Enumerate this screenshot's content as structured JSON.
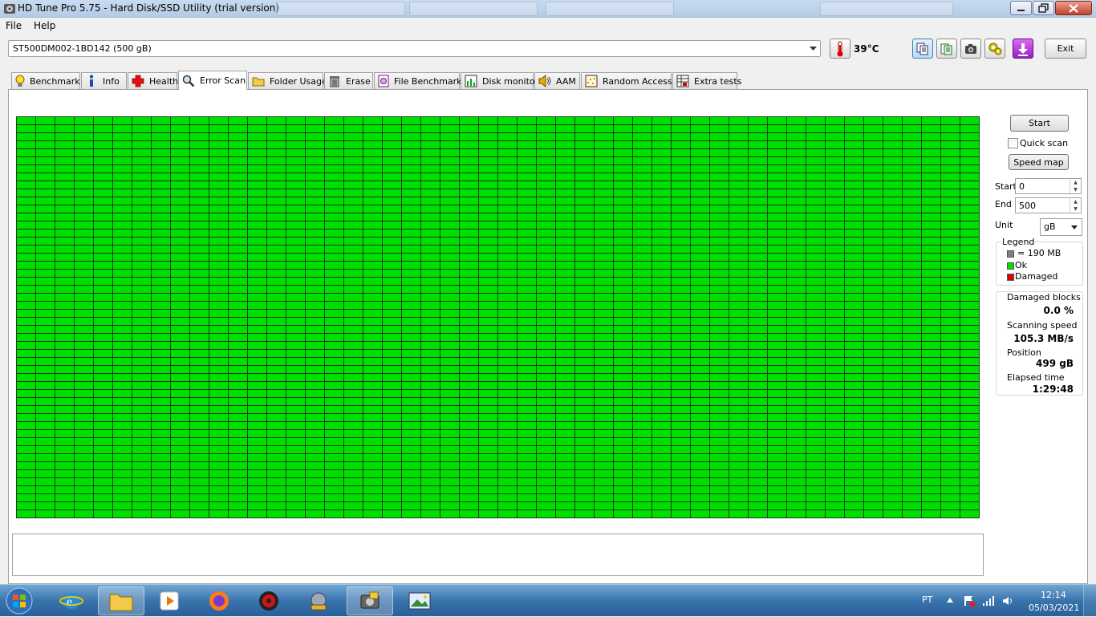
{
  "window": {
    "title": "HD Tune Pro 5.75 - Hard Disk/SSD Utility (trial version)"
  },
  "menu": {
    "file": "File",
    "help": "Help"
  },
  "toolbar": {
    "drive": "ST500DM002-1BD142 (500 gB)",
    "temperature": "39°C",
    "exit": "Exit"
  },
  "tabs": [
    {
      "label": "Benchmark"
    },
    {
      "label": "Info"
    },
    {
      "label": "Health"
    },
    {
      "label": "Error Scan"
    },
    {
      "label": "Folder Usage"
    },
    {
      "label": "Erase"
    },
    {
      "label": "File Benchmark"
    },
    {
      "label": "Disk monitor"
    },
    {
      "label": "AAM"
    },
    {
      "label": "Random Access"
    },
    {
      "label": "Extra tests"
    }
  ],
  "scan": {
    "start_button": "Start",
    "quick_scan_label": "Quick scan",
    "quick_scan_checked": false,
    "speed_map_button": "Speed map",
    "start_label": "Start",
    "start_value": "0",
    "end_label": "End",
    "end_value": "500",
    "unit_label": "Unit",
    "unit_value": "gB"
  },
  "legend": {
    "title": "Legend",
    "block_size": "= 190 MB",
    "ok": "Ok",
    "damaged": "Damaged",
    "colors": {
      "block": "#808080",
      "ok": "#00e000",
      "damaged": "#e00000"
    }
  },
  "stats": {
    "damaged_label": "Damaged blocks",
    "damaged_value": "0.0 %",
    "speed_label": "Scanning speed",
    "speed_value": "105.3 MB/s",
    "position_label": "Position",
    "position_value": "499 gB",
    "elapsed_label": "Elapsed time",
    "elapsed_value": "1:29:48"
  },
  "taskbar": {
    "language": "PT",
    "time": "12:14",
    "date": "05/03/2021"
  }
}
